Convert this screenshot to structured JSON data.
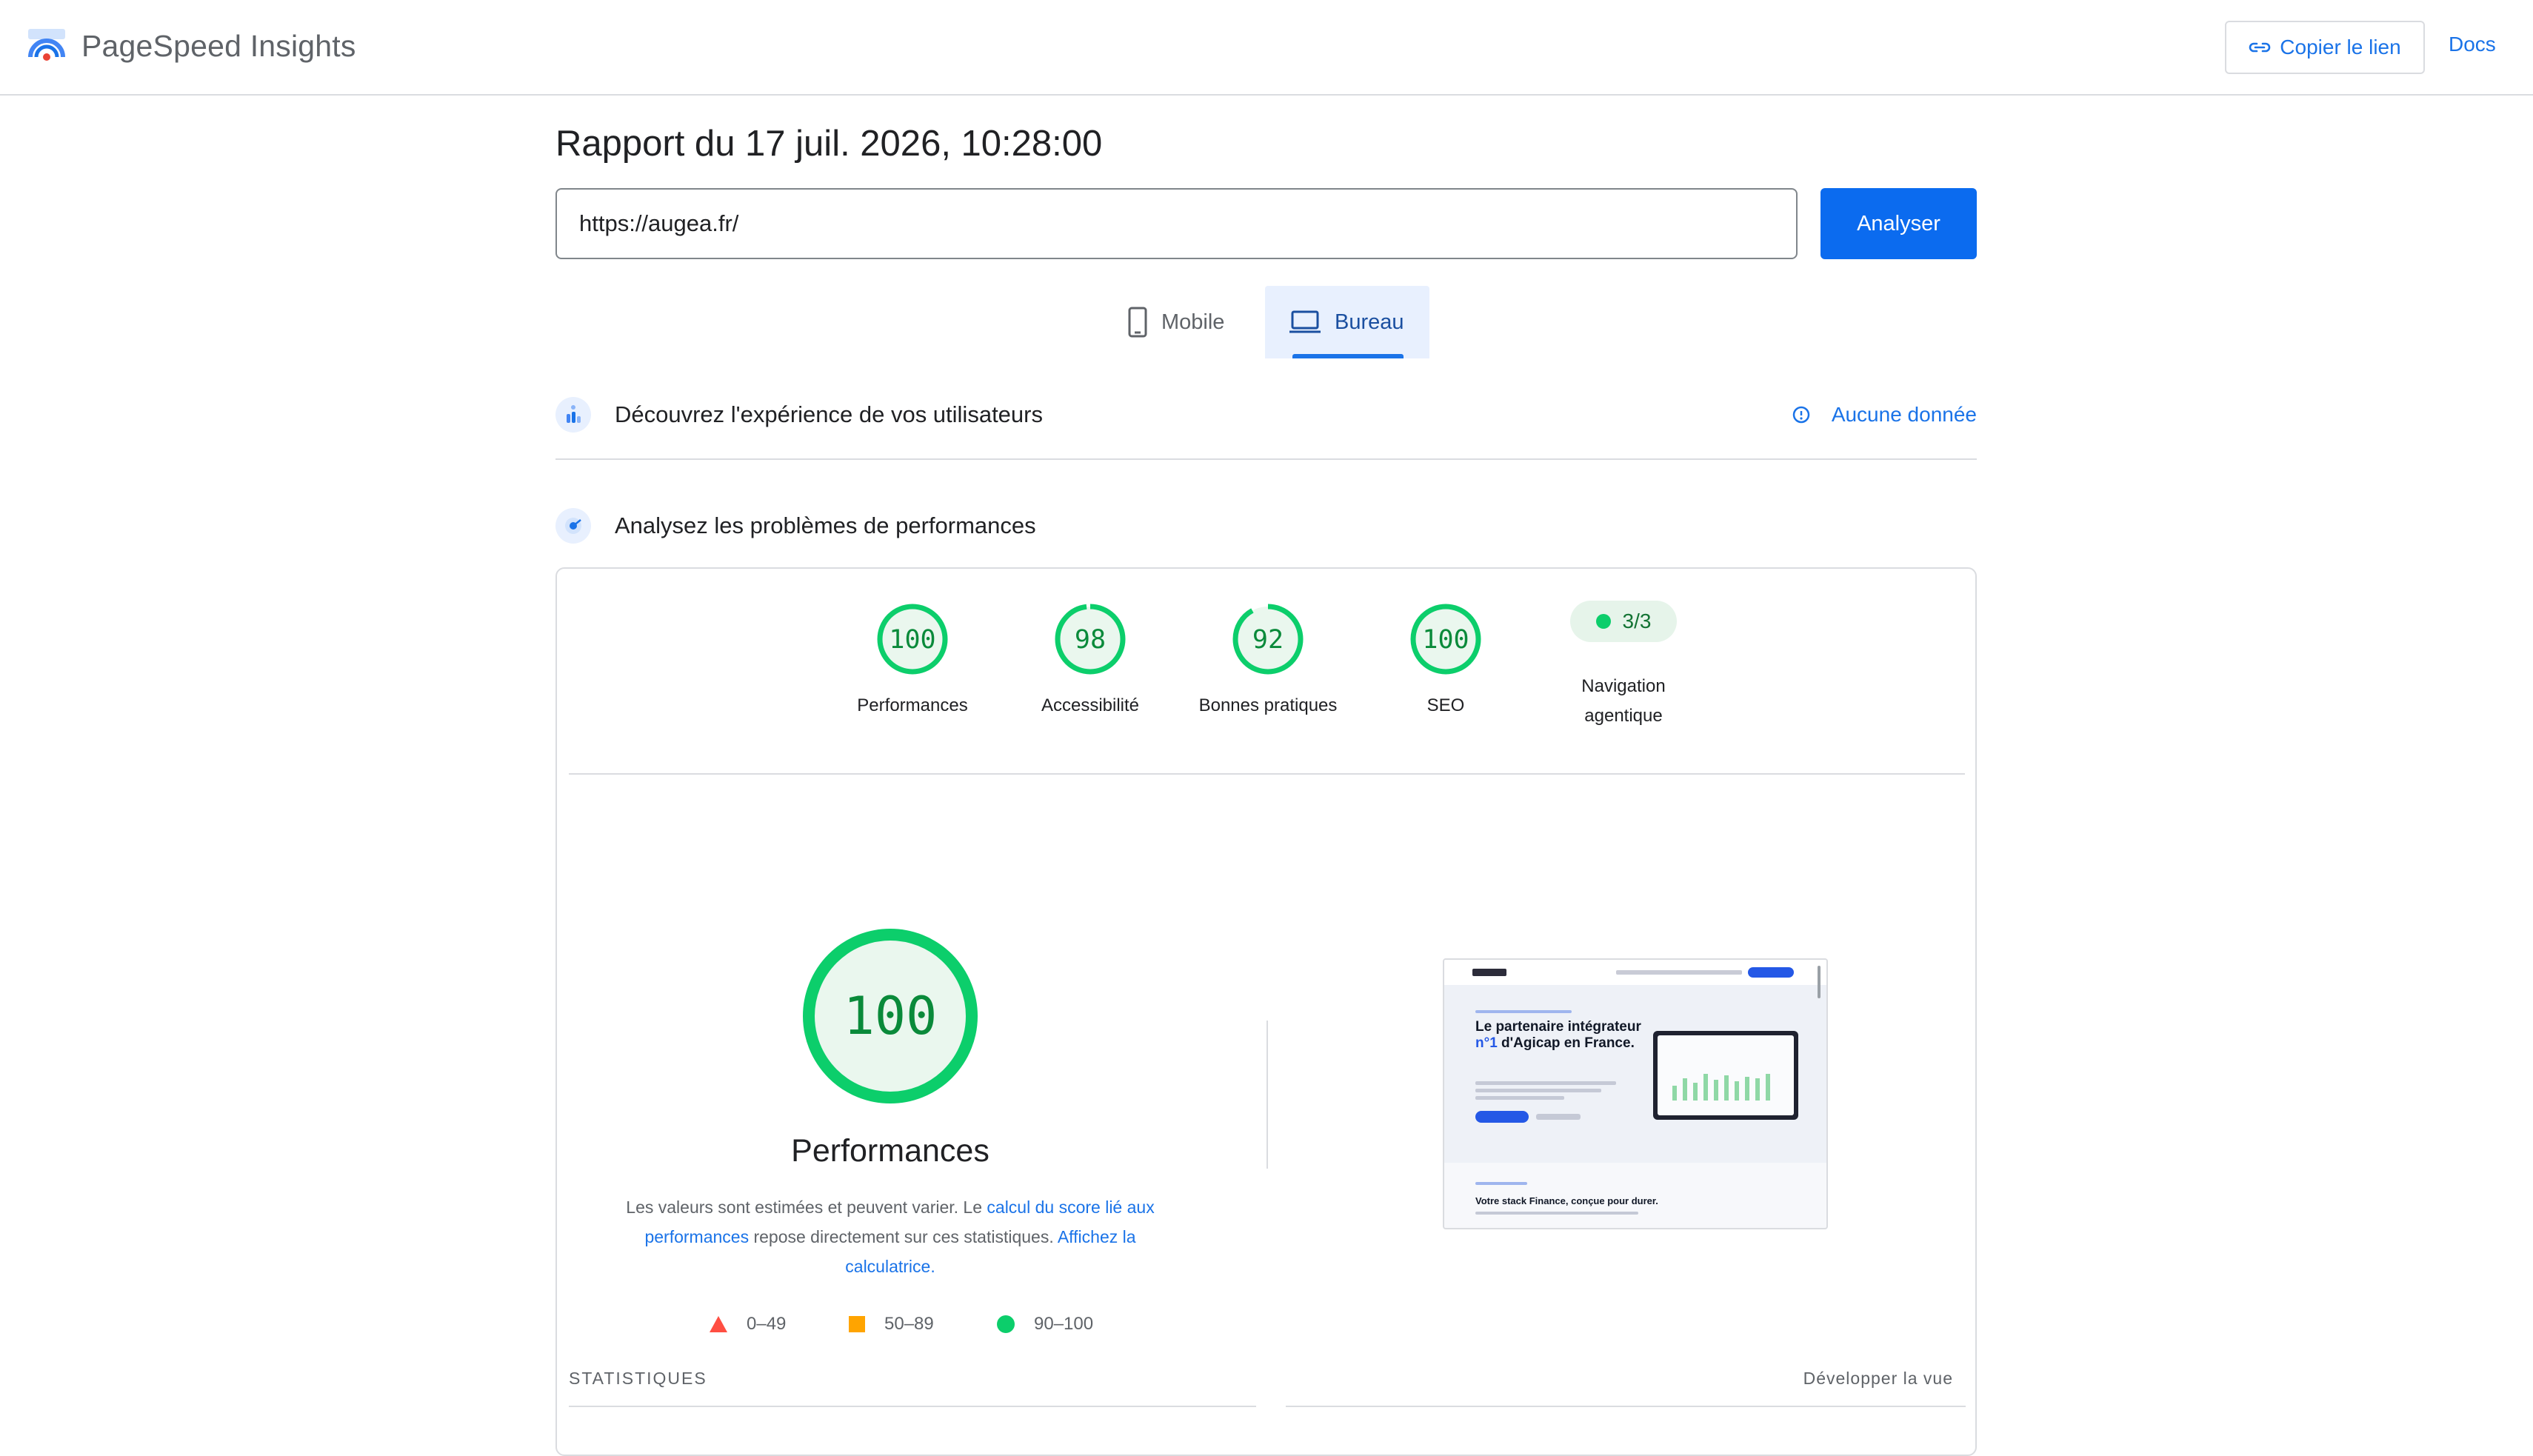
{
  "app": {
    "name": "PageSpeed Insights"
  },
  "header": {
    "copy_link_label": "Copier le lien",
    "docs_label": "Docs"
  },
  "report": {
    "title": "Rapport du 17 juil. 2026, 10:28:00"
  },
  "search": {
    "url_value": "https://augea.fr/",
    "analyze_label": "Analyser"
  },
  "tabs": [
    {
      "label": "Mobile",
      "icon": "phone-icon",
      "selected": false
    },
    {
      "label": "Bureau",
      "icon": "laptop-icon",
      "selected": true
    }
  ],
  "sections": {
    "experience": {
      "title": "Découvrez l'expérience de vos utilisateurs",
      "no_data_label": "Aucune donnée"
    },
    "diagnose": {
      "title": "Analysez les problèmes de performances"
    }
  },
  "scores": [
    {
      "value": 100,
      "label": "Performances"
    },
    {
      "value": 98,
      "label": "Accessibilité"
    },
    {
      "value": 92,
      "label": "Bonnes pratiques"
    },
    {
      "value": 100,
      "label": "SEO"
    }
  ],
  "agentic": {
    "value": "3/3",
    "label_line1": "Navigation",
    "label_line2": "agentique"
  },
  "performance": {
    "score": 100,
    "title": "Performances",
    "desc_part1": "Les valeurs sont estimées et peuvent varier. Le ",
    "desc_link1": "calcul du score lié aux performances",
    "desc_part2": " repose directement sur ces statistiques. ",
    "desc_link2": "Affichez la calculatrice."
  },
  "legend": [
    {
      "range": "0–49",
      "color": "#ff4e42"
    },
    {
      "range": "50–89",
      "color": "#ffa400"
    },
    {
      "range": "90–100",
      "color": "#0cce6b"
    }
  ],
  "screenshot_preview": {
    "headline_part1": "Le partenaire intégrateur ",
    "headline_accent": "n°1",
    "headline_part2": " d'Agicap en France.",
    "subheading": "Votre stack Finance, conçue pour durer."
  },
  "stats": {
    "label": "STATISTIQUES",
    "expand_label": "Développer la vue"
  },
  "colors": {
    "accent": "#1a73e8",
    "pass": "#0cce6b",
    "pass_text": "#0a8a3a"
  }
}
